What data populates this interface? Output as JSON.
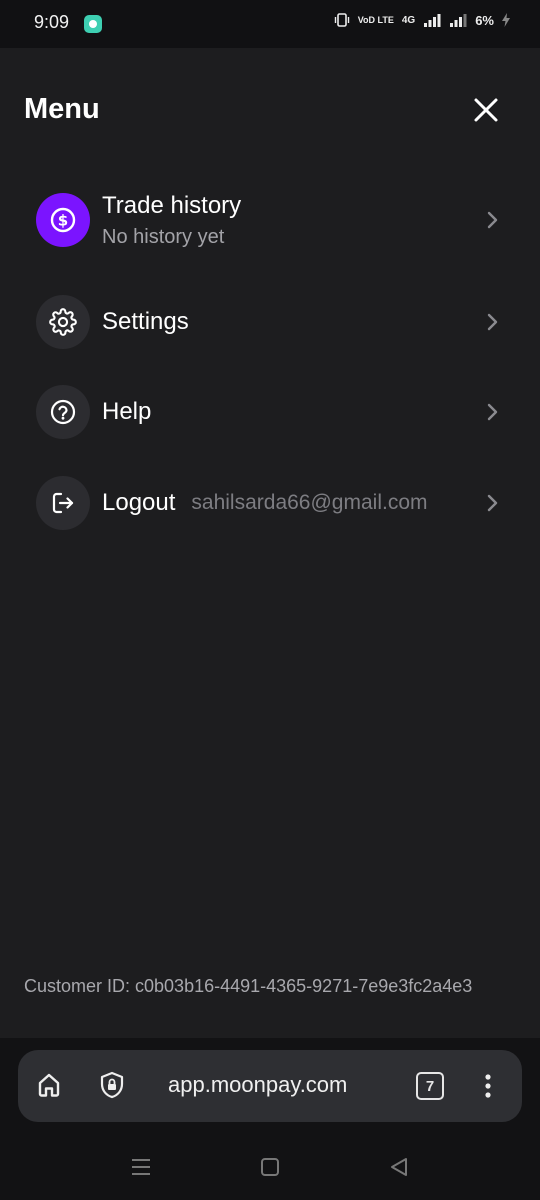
{
  "status_bar": {
    "time": "9:09",
    "net_label": "VoD LTE",
    "net2_label": "4G",
    "battery": "6%"
  },
  "menu": {
    "title": "Menu",
    "items": [
      {
        "label": "Trade history",
        "sublabel": "No history yet",
        "icon": "dollar-icon"
      },
      {
        "label": "Settings",
        "icon": "gear-icon"
      },
      {
        "label": "Help",
        "icon": "help-icon"
      },
      {
        "label": "Logout",
        "email": "sahilsarda66@gmail.com",
        "icon": "logout-icon"
      }
    ],
    "customer_id": "Customer ID: c0b03b16-4491-4365-9271-7e9e3fc2a4e3"
  },
  "browser": {
    "url": "app.moonpay.com",
    "tab_count": "7"
  },
  "colors": {
    "accent": "#7b14ff",
    "panel_bg": "#1d1d1f",
    "icon_bg": "#2c2c30"
  }
}
